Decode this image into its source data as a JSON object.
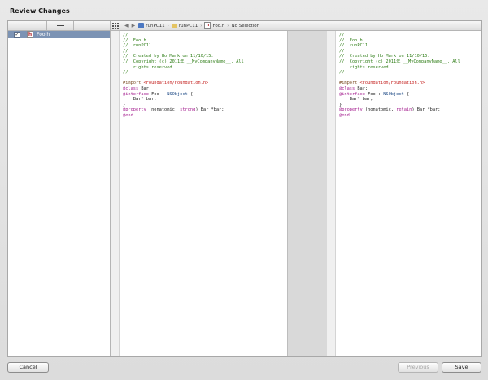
{
  "window": {
    "title": "Review Changes"
  },
  "sidebar": {
    "files": [
      {
        "checked": true,
        "icon": "header-file-icon",
        "name": "Foo.h"
      }
    ]
  },
  "jumpbar": {
    "segments": [
      "runPC11",
      "runPC11",
      "Foo.h",
      "No Selection"
    ]
  },
  "left_pane": {
    "lines": [
      [
        {
          "t": "//",
          "c": "c-comment"
        }
      ],
      [
        {
          "t": "//  Foo.h",
          "c": "c-comment"
        }
      ],
      [
        {
          "t": "//  runPC11",
          "c": "c-comment"
        }
      ],
      [
        {
          "t": "//",
          "c": "c-comment"
        }
      ],
      [
        {
          "t": "//  Created by Ho Mark on 11/10/15.",
          "c": "c-comment"
        }
      ],
      [
        {
          "t": "//  Copyright (c) 2011年 __MyCompanyName__. All",
          "c": "c-comment"
        }
      ],
      [
        {
          "t": "    rights reserved.",
          "c": "c-comment"
        }
      ],
      [
        {
          "t": "//",
          "c": "c-comment"
        }
      ],
      [
        {
          "t": "",
          "c": ""
        }
      ],
      [
        {
          "t": "#import ",
          "c": "c-pre"
        },
        {
          "t": "<Foundation/Foundation.h>",
          "c": "c-str"
        }
      ],
      [
        {
          "t": "@class ",
          "c": "c-kw"
        },
        {
          "t": "Bar;",
          "c": ""
        }
      ],
      [
        {
          "t": "@interface ",
          "c": "c-kw"
        },
        {
          "t": "Foo : ",
          "c": ""
        },
        {
          "t": "NSObject",
          "c": "c-cls"
        },
        {
          "t": " {",
          "c": ""
        }
      ],
      [
        {
          "t": "    Bar* bar;",
          "c": ""
        }
      ],
      [
        {
          "t": "}",
          "c": ""
        }
      ],
      [
        {
          "t": "@property ",
          "c": "c-kw"
        },
        {
          "t": "(nonatomic, ",
          "c": ""
        },
        {
          "t": "strong",
          "c": "c-kw"
        },
        {
          "t": ") Bar *bar;",
          "c": ""
        }
      ],
      [
        {
          "t": "@end",
          "c": "c-kw"
        }
      ]
    ]
  },
  "right_pane": {
    "lines": [
      [
        {
          "t": "//",
          "c": "c-comment"
        }
      ],
      [
        {
          "t": "//  Foo.h",
          "c": "c-comment"
        }
      ],
      [
        {
          "t": "//  runPC11",
          "c": "c-comment"
        }
      ],
      [
        {
          "t": "//",
          "c": "c-comment"
        }
      ],
      [
        {
          "t": "//  Created by Ho Mark on 11/10/15.",
          "c": "c-comment"
        }
      ],
      [
        {
          "t": "//  Copyright (c) 2011年 __MyCompanyName__. All",
          "c": "c-comment"
        }
      ],
      [
        {
          "t": "    rights reserved.",
          "c": "c-comment"
        }
      ],
      [
        {
          "t": "//",
          "c": "c-comment"
        }
      ],
      [
        {
          "t": "",
          "c": ""
        }
      ],
      [
        {
          "t": "#import ",
          "c": "c-pre"
        },
        {
          "t": "<Foundation/Foundation.h>",
          "c": "c-str"
        }
      ],
      [
        {
          "t": "@class ",
          "c": "c-kw"
        },
        {
          "t": "Bar;",
          "c": ""
        }
      ],
      [
        {
          "t": "@interface ",
          "c": "c-kw"
        },
        {
          "t": "Foo : ",
          "c": ""
        },
        {
          "t": "NSObject",
          "c": "c-cls"
        },
        {
          "t": " {",
          "c": ""
        }
      ],
      [
        {
          "t": "    Bar* bar;",
          "c": ""
        }
      ],
      [
        {
          "t": "}",
          "c": ""
        }
      ],
      [
        {
          "t": "@property ",
          "c": "c-kw"
        },
        {
          "t": "(nonatomic, ",
          "c": ""
        },
        {
          "t": "retain",
          "c": "c-kw"
        },
        {
          "t": ") Bar *bar;",
          "c": ""
        }
      ],
      [
        {
          "t": "@end",
          "c": "c-kw"
        }
      ]
    ]
  },
  "buttons": {
    "cancel": "Cancel",
    "previous": "Previous",
    "save": "Save"
  }
}
